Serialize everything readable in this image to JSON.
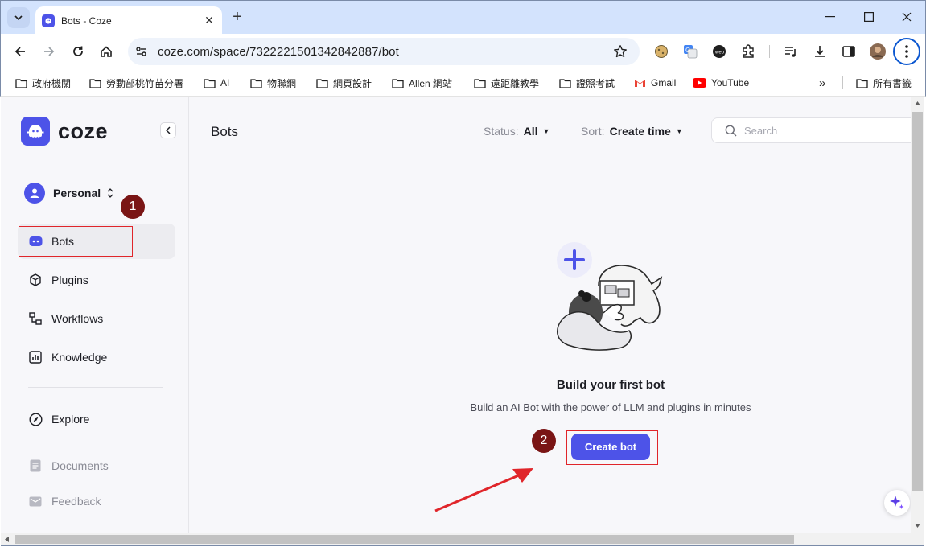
{
  "browser": {
    "tab_title": "Bots - Coze",
    "url": "coze.com/space/7322221501342842887/bot",
    "bookmarks": [
      {
        "label": "政府機關",
        "icon": "folder-icon"
      },
      {
        "label": "勞動部桃竹苗分署",
        "icon": "folder-icon"
      },
      {
        "label": "AI",
        "icon": "folder-icon"
      },
      {
        "label": "物聯網",
        "icon": "folder-icon"
      },
      {
        "label": "網頁設計",
        "icon": "folder-icon"
      },
      {
        "label": "Allen 網站",
        "icon": "folder-icon"
      },
      {
        "label": "遠距離教學",
        "icon": "folder-icon"
      },
      {
        "label": "證照考試",
        "icon": "folder-icon"
      },
      {
        "label": "Gmail",
        "icon": "gmail-icon"
      },
      {
        "label": "YouTube",
        "icon": "youtube-icon"
      }
    ],
    "bookmarks_more": "»",
    "all_bookmarks": "所有書籤"
  },
  "app": {
    "brand": "coze",
    "brand_color": "#4d53e8",
    "workspace": "Personal",
    "nav": {
      "bots": "Bots",
      "plugins": "Plugins",
      "workflows": "Workflows",
      "knowledge": "Knowledge",
      "explore": "Explore",
      "documents": "Documents",
      "feedback": "Feedback"
    }
  },
  "main": {
    "title": "Bots",
    "status_label": "Status:",
    "status_value": "All",
    "sort_label": "Sort:",
    "sort_value": "Create time",
    "search_placeholder": "Search",
    "empty_title": "Build your first bot",
    "empty_subtitle": "Build an AI Bot with the power of LLM and plugins in minutes",
    "create_button": "Create bot"
  },
  "annotations": {
    "step1": "1",
    "step2": "2",
    "color": "#e0252a"
  }
}
